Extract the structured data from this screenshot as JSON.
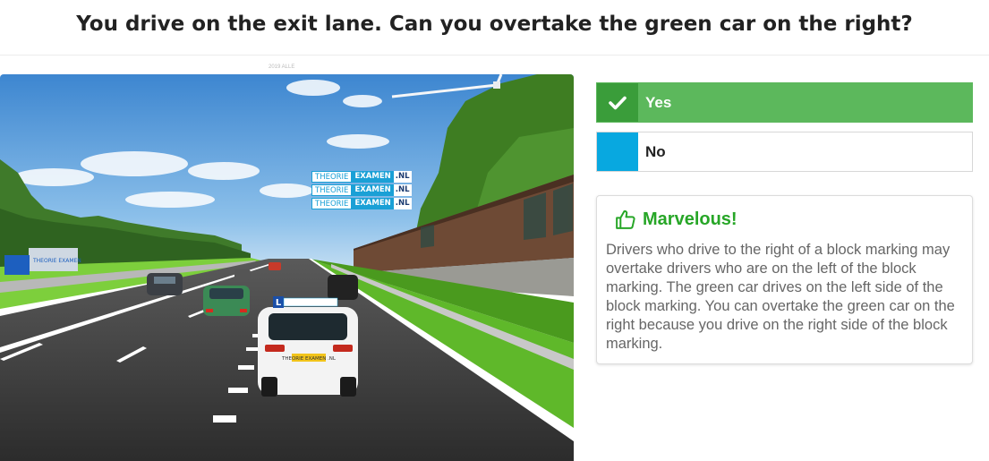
{
  "question": {
    "title": "You drive on the exit lane. Can you overtake the green car on the right?"
  },
  "image": {
    "watermark": "2019 ALLE",
    "sign_rows": [
      {
        "a": "THEORIE",
        "b": "EXAMEN",
        "c": ".NL"
      },
      {
        "a": "THEORIE",
        "b": "EXAMEN",
        "c": ".NL"
      },
      {
        "a": "THEORIE",
        "b": "EXAMEN",
        "c": ".NL"
      }
    ],
    "learner_plate": "L",
    "car_plate": "THEORIE EXAMEN .NL",
    "truck_text": "THEORIE EXAMEN"
  },
  "answers": {
    "yes": {
      "label": "Yes",
      "icon": "check-icon",
      "state": "selected-correct",
      "color": "#5cb85c"
    },
    "no": {
      "label": "No",
      "icon": "none",
      "color": "#08a8e0"
    }
  },
  "feedback": {
    "icon": "thumbs-up-icon",
    "title": "Marvelous!",
    "text": "Drivers who drive to the right of a block marking may overtake drivers who are on the left of the block marking. The green car drives on the left side of the block marking. You can overtake the green car on the right because you drive on the right side of the block marking.",
    "title_color": "#27a627"
  }
}
